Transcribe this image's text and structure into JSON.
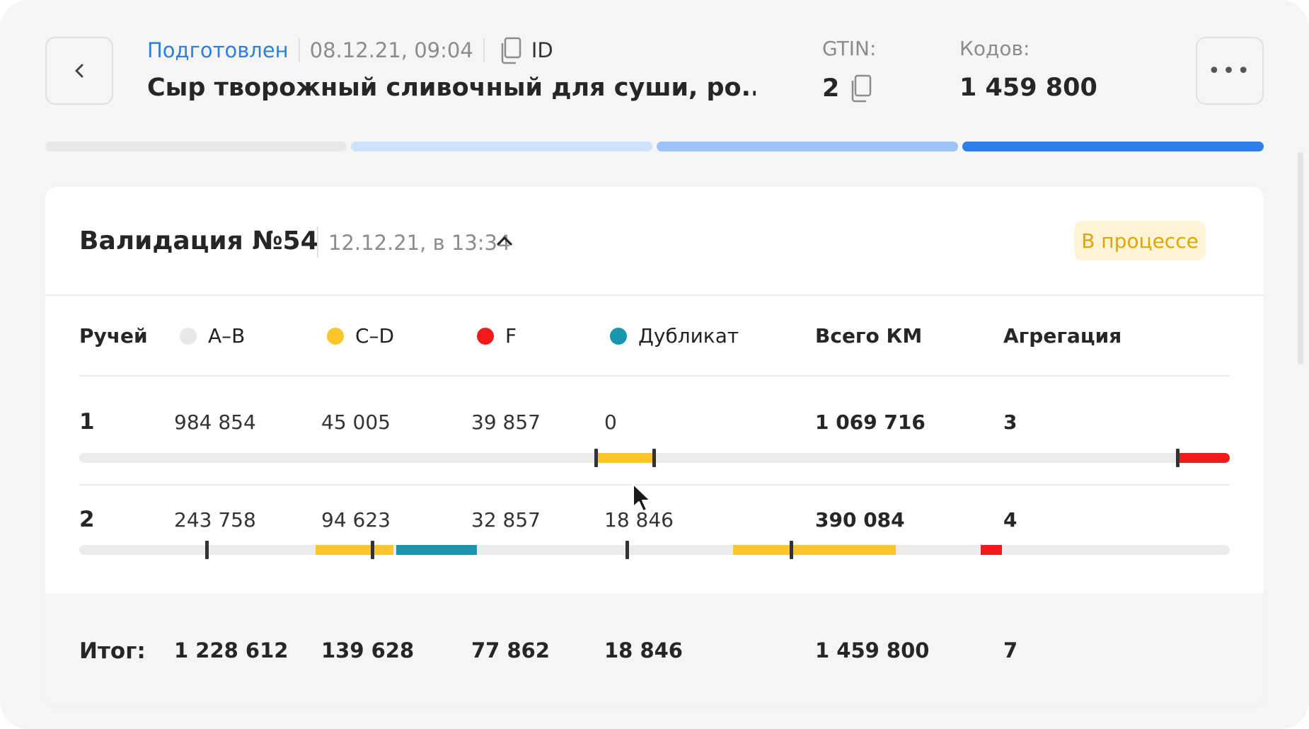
{
  "header": {
    "status": "Подготовлен",
    "date": "08.12.21, 09:04",
    "id_label": "ID",
    "title": "Сыр творожный сливочный для суши, ро...",
    "gtin_label": "GTIN:",
    "gtin_value": "2",
    "codes_label": "Кодов:",
    "codes_value": "1 459 800",
    "more_label": "•••"
  },
  "progress": {
    "segments": [
      {
        "color": "#e8e8e8"
      },
      {
        "color": "#cfe2fb"
      },
      {
        "color": "#9ec4f5"
      },
      {
        "color": "#2f7fe6"
      }
    ]
  },
  "validation": {
    "title": "Валидация №54",
    "date": "12.12.21, в 13:34",
    "status": "В процессе",
    "columns": {
      "stream": "Ручей",
      "ab": "A–B",
      "cd": "C–D",
      "f": "F",
      "duplicate": "Дубликат",
      "total": "Всего КМ",
      "aggregation": "Агрегация"
    },
    "legend_colors": {
      "ab": "#e8e8e8",
      "cd": "#fcc62a",
      "f": "#f41a1a",
      "duplicate": "#1896ad"
    },
    "rows": [
      {
        "stream": "1",
        "ab": "984 854",
        "cd": "45 005",
        "f": "39 857",
        "duplicate": "0",
        "total": "1 069 716",
        "aggregation": "3"
      },
      {
        "stream": "2",
        "ab": "243 758",
        "cd": "94 623",
        "f": "32 857",
        "duplicate": "18 846",
        "total": "390 084",
        "aggregation": "4"
      }
    ],
    "footer": {
      "label": "Итог:",
      "ab": "1 228 612",
      "cd": "139 628",
      "f": "77 862",
      "duplicate": "18 846",
      "total": "1 459 800",
      "aggregation": "7"
    }
  }
}
